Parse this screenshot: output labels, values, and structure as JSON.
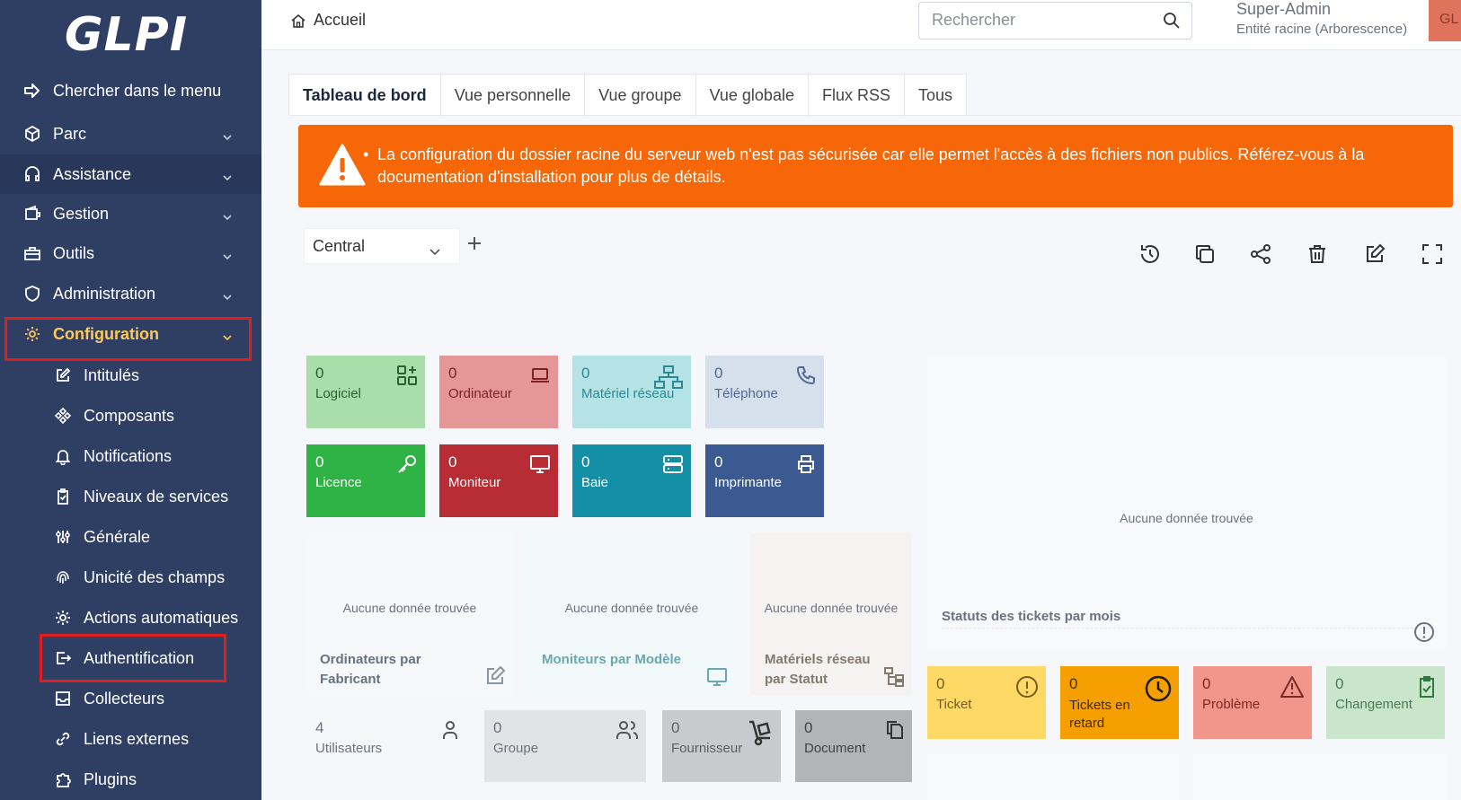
{
  "sidebar": {
    "logo": "GLPI",
    "menu": [
      {
        "label": "Chercher dans le menu"
      },
      {
        "label": "Parc"
      },
      {
        "label": "Assistance"
      },
      {
        "label": "Gestion"
      },
      {
        "label": "Outils"
      },
      {
        "label": "Administration"
      },
      {
        "label": "Configuration"
      }
    ],
    "submenu": [
      {
        "label": "Intitulés"
      },
      {
        "label": "Composants"
      },
      {
        "label": "Notifications"
      },
      {
        "label": "Niveaux de services"
      },
      {
        "label": "Générale"
      },
      {
        "label": "Unicité des champs"
      },
      {
        "label": "Actions automatiques"
      },
      {
        "label": "Authentification"
      },
      {
        "label": "Collecteurs"
      },
      {
        "label": "Liens externes"
      },
      {
        "label": "Plugins"
      }
    ]
  },
  "header": {
    "breadcrumb": "Accueil",
    "search_placeholder": "Rechercher",
    "user_name": "Super-Admin",
    "user_entity": "Entité racine (Arborescence)",
    "avatar_initials": "GL"
  },
  "tabs": [
    {
      "label": "Tableau de bord"
    },
    {
      "label": "Vue personnelle"
    },
    {
      "label": "Vue groupe"
    },
    {
      "label": "Vue globale"
    },
    {
      "label": "Flux RSS"
    },
    {
      "label": "Tous"
    }
  ],
  "alert": {
    "message": "La configuration du dossier racine du serveur web n'est pas sécurisée car elle permet l'accès à des fichiers non publics. Référez-vous à la documentation d'installation pour plus de détails."
  },
  "dashboard": {
    "selected": "Central"
  },
  "cards": {
    "row1": [
      {
        "count": "0",
        "label": "Logiciel"
      },
      {
        "count": "0",
        "label": "Ordinateur"
      },
      {
        "count": "0",
        "label": "Matériel réseau"
      },
      {
        "count": "0",
        "label": "Téléphone"
      }
    ],
    "row2": [
      {
        "count": "0",
        "label": "Licence"
      },
      {
        "count": "0",
        "label": "Moniteur"
      },
      {
        "count": "0",
        "label": "Baie"
      },
      {
        "count": "0",
        "label": "Imprimante"
      }
    ],
    "row4": [
      {
        "count": "4",
        "label": "Utilisateurs"
      },
      {
        "count": "0",
        "label": "Groupe"
      },
      {
        "count": "0",
        "label": "Fournisseur"
      },
      {
        "count": "0",
        "label": "Document"
      }
    ],
    "tickets": [
      {
        "count": "0",
        "label": "Ticket"
      },
      {
        "count": "0",
        "label": "Tickets en retard"
      },
      {
        "count": "0",
        "label": "Problème"
      },
      {
        "count": "0",
        "label": "Changement"
      }
    ]
  },
  "widgets": {
    "empty_text": "Aucune donnée trouvée",
    "computers_by_maker": "Ordinateurs par Fabricant",
    "monitors_by_model": "Moniteurs par Modèle",
    "network_by_status": "Matériels réseau par Statut",
    "tickets_status_by_month": "Statuts des tickets par mois"
  }
}
